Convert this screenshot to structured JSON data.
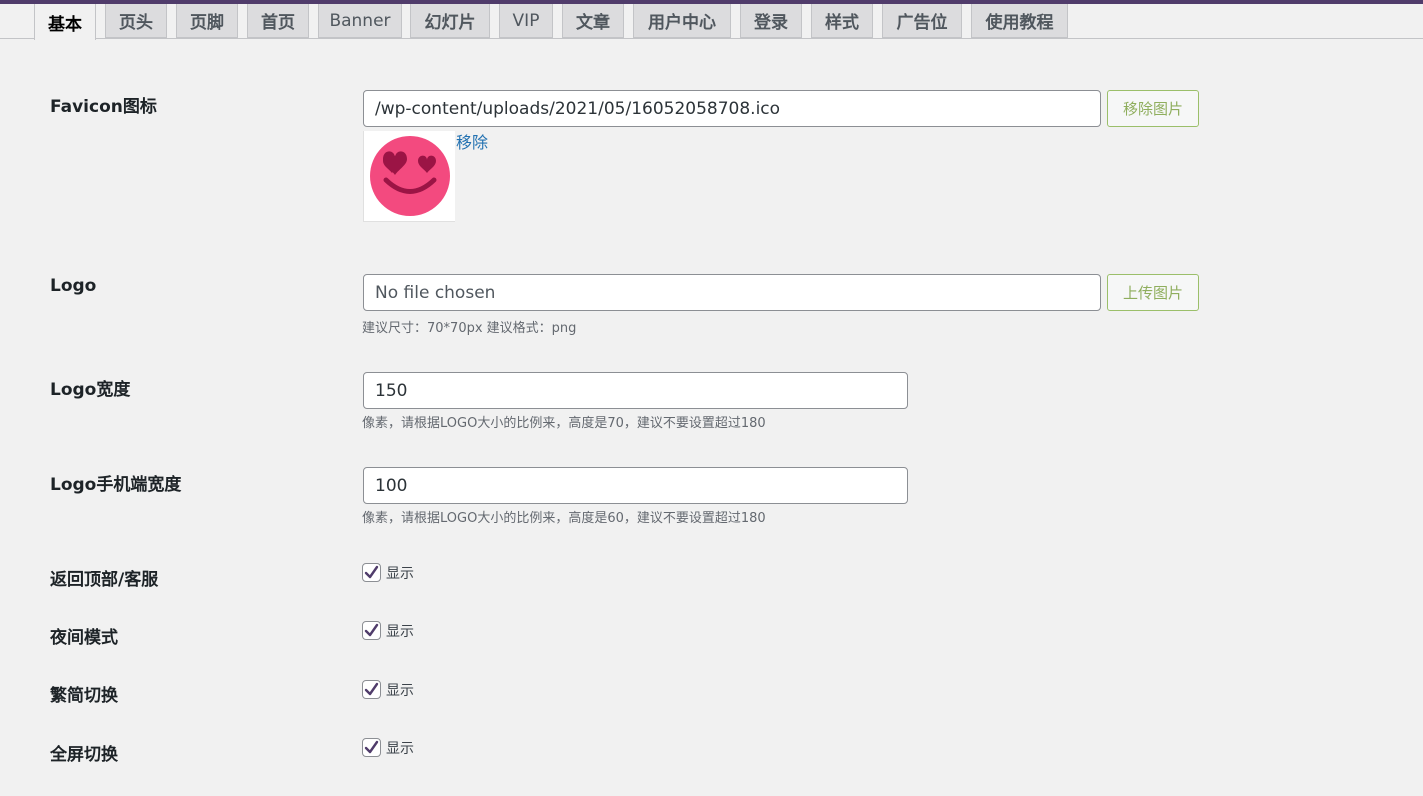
{
  "tabs": [
    {
      "label": "基本",
      "active": true
    },
    {
      "label": "页头"
    },
    {
      "label": "页脚"
    },
    {
      "label": "首页"
    },
    {
      "label": "Banner"
    },
    {
      "label": "幻灯片"
    },
    {
      "label": "VIP"
    },
    {
      "label": "文章"
    },
    {
      "label": "用户中心"
    },
    {
      "label": "登录"
    },
    {
      "label": "样式"
    },
    {
      "label": "广告位"
    },
    {
      "label": "使用教程"
    }
  ],
  "favicon": {
    "label": "Favicon图标",
    "value": "/wp-content/uploads/2021/05/16052058708.ico",
    "button": "移除图片",
    "remove_link": "移除"
  },
  "logo": {
    "label": "Logo",
    "placeholder": "No file chosen",
    "button": "上传图片",
    "hint": "建议尺寸：70*70px 建议格式：png"
  },
  "logo_width": {
    "label": "Logo宽度",
    "value": "150",
    "hint": "像素，请根据LOGO大小的比例来，高度是70，建议不要设置超过180"
  },
  "logo_mobile_width": {
    "label": "Logo手机端宽度",
    "value": "100",
    "hint": "像素，请根据LOGO大小的比例来，高度是60，建议不要设置超过180"
  },
  "toggles": [
    {
      "label": "返回顶部/客服",
      "check_label": "显示",
      "checked": true
    },
    {
      "label": "夜间模式",
      "check_label": "显示",
      "checked": true
    },
    {
      "label": "繁简切换",
      "check_label": "显示",
      "checked": true
    },
    {
      "label": "全屏切换",
      "check_label": "显示",
      "checked": true
    }
  ],
  "colors": {
    "accent": "#503c6b",
    "button_text": "#8fae5d",
    "link": "#2271b1",
    "emoji_face": "#f34a7f",
    "emoji_features": "#9b1445"
  }
}
